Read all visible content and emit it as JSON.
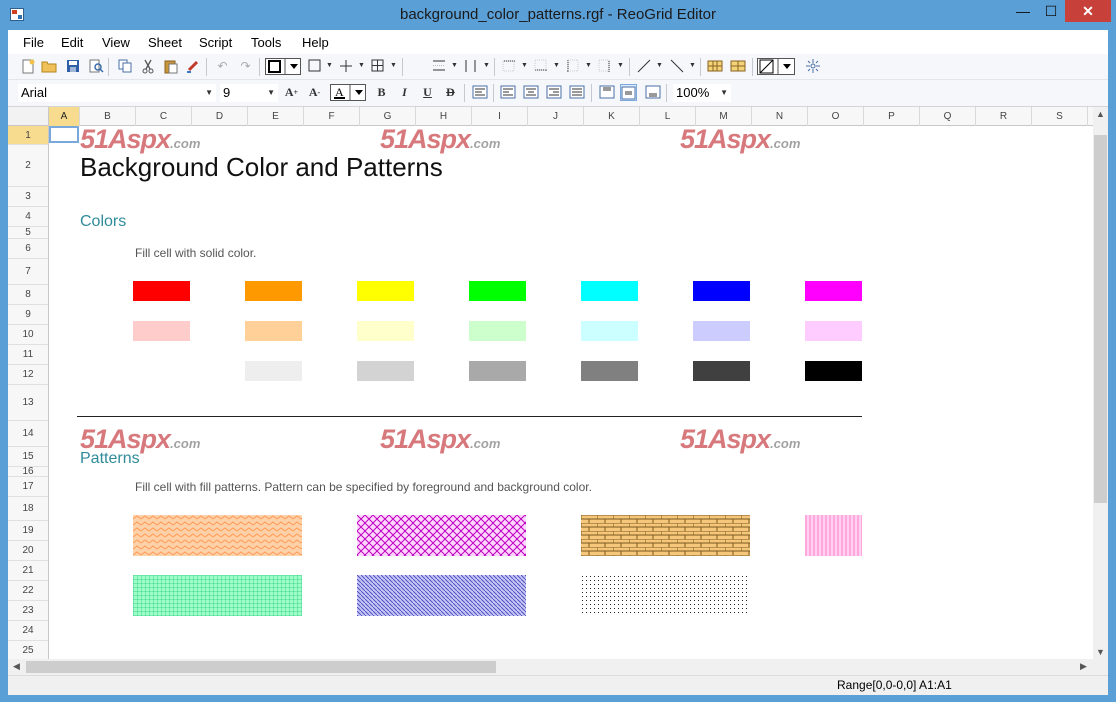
{
  "window": {
    "title": "background_color_patterns.rgf - ReoGrid Editor",
    "minimize": "—",
    "maximize": "☐",
    "close": "✕"
  },
  "menu": [
    "File",
    "Edit",
    "View",
    "Sheet",
    "Script",
    "Tools",
    "Help"
  ],
  "font_bar": {
    "font_name": "Arial",
    "font_size": "9",
    "zoom": "100%"
  },
  "columns": [
    "A",
    "B",
    "C",
    "D",
    "E",
    "F",
    "G",
    "H",
    "I",
    "J",
    "K",
    "L",
    "M",
    "N",
    "O",
    "P",
    "Q",
    "R",
    "S"
  ],
  "rows": [
    "1",
    "2",
    "3",
    "4",
    "5",
    "6",
    "7",
    "8",
    "9",
    "10",
    "11",
    "12",
    "13",
    "14",
    "15",
    "16",
    "17",
    "18",
    "19",
    "20",
    "21",
    "22",
    "23",
    "24",
    "25"
  ],
  "sheet": {
    "watermark_big": "51Aspx",
    "watermark_small": ".com",
    "title": "Background Color and Patterns",
    "colors_heading": "Colors",
    "colors_desc": "Fill cell with solid color.",
    "patterns_heading": "Patterns",
    "patterns_desc": "Fill cell with fill patterns. Pattern can be specified by foreground and background color."
  },
  "swatch_colors": {
    "row1": [
      "#ff0000",
      "#ff9900",
      "#ffff00",
      "#00ff00",
      "#00ffff",
      "#0000ff",
      "#ff00ff"
    ],
    "row2": [
      "#ffcccc",
      "#ffd199",
      "#ffffcc",
      "#ccffcc",
      "#ccffff",
      "#ccccff",
      "#ffccff"
    ],
    "row3": [
      "#eeeeee",
      "#d3d3d3",
      "#a9a9a9",
      "#808080",
      "#404040",
      "#000000"
    ]
  },
  "status": {
    "text": "Range[0,0-0,0] A1:A1"
  }
}
